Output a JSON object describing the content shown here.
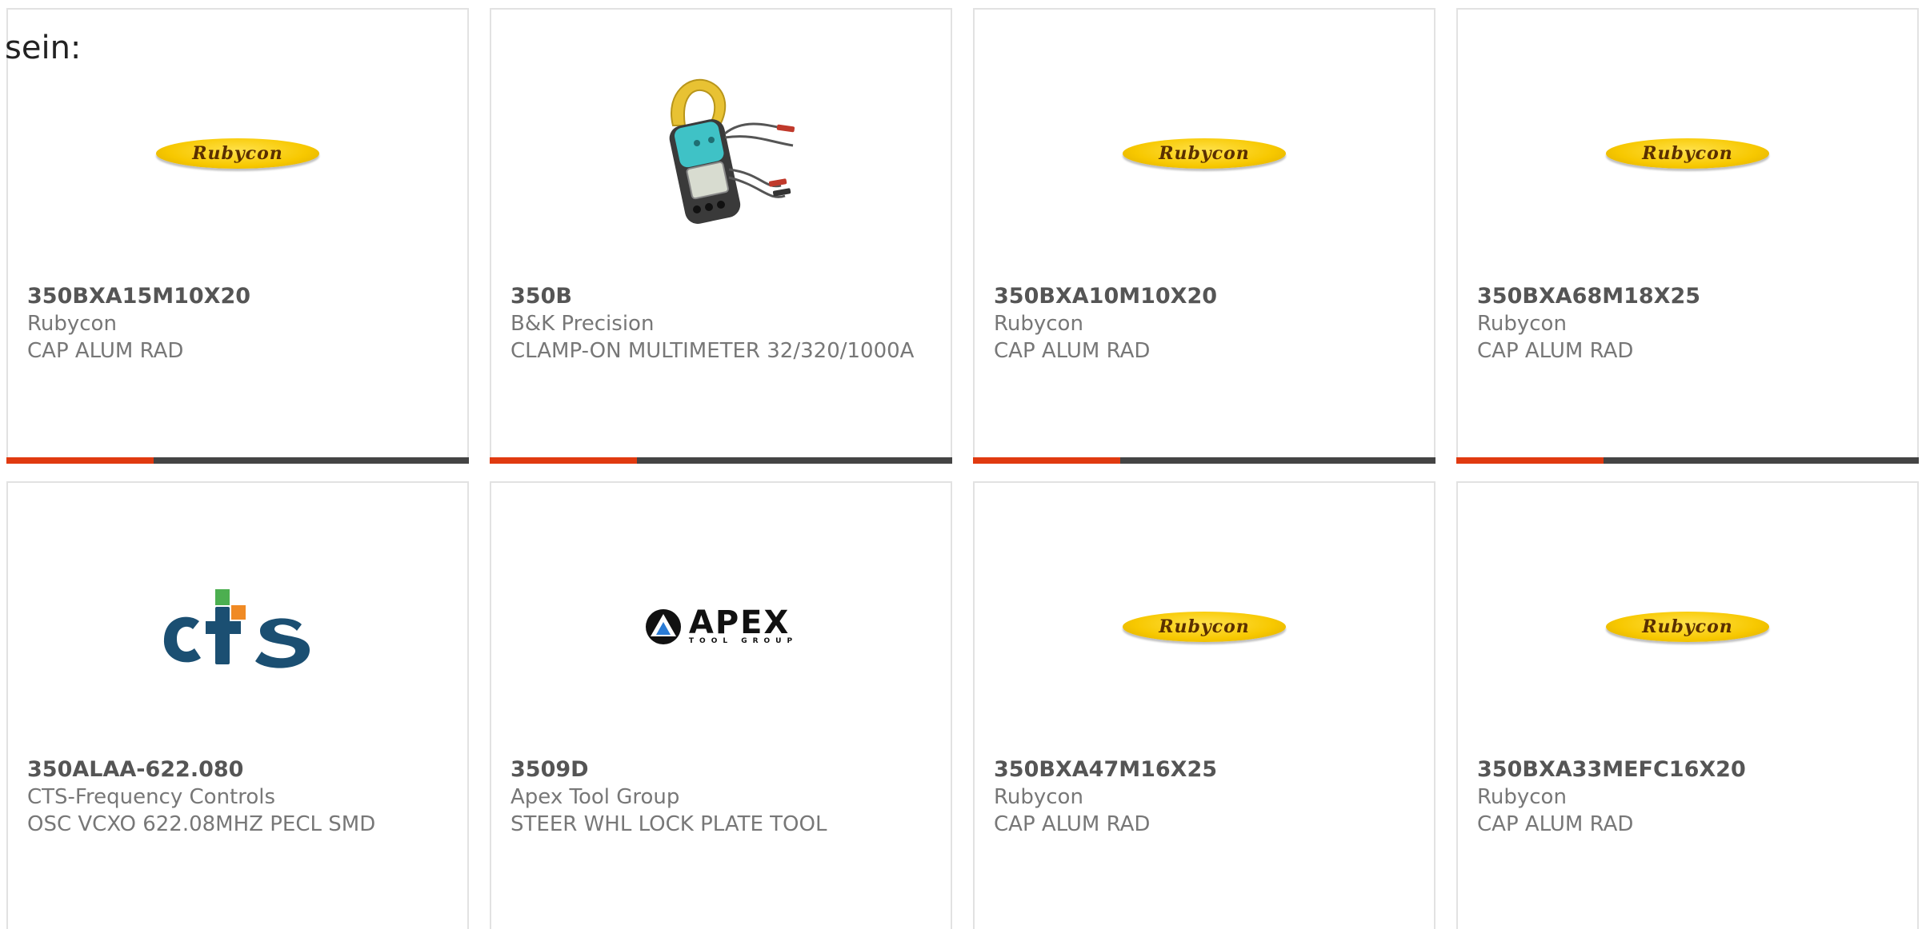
{
  "prefix_text": "sein:",
  "products": [
    {
      "part": "350BXA15M10X20",
      "manufacturer": "Rubycon",
      "description": "CAP ALUM RAD",
      "logo": "rubycon-logo",
      "logo_text": "Rubycon"
    },
    {
      "part": "350B",
      "manufacturer": "B&K Precision",
      "description": "CLAMP-ON MULTIMETER 32/320/1000A",
      "logo": "clamp-meter-photo"
    },
    {
      "part": "350BXA10M10X20",
      "manufacturer": "Rubycon",
      "description": "CAP ALUM RAD",
      "logo": "rubycon-logo",
      "logo_text": "Rubycon"
    },
    {
      "part": "350BXA68M18X25",
      "manufacturer": "Rubycon",
      "description": "CAP ALUM RAD",
      "logo": "rubycon-logo",
      "logo_text": "Rubycon"
    },
    {
      "part": "350ALAA-622.080",
      "manufacturer": "CTS-Frequency Controls",
      "description": "OSC VCXO 622.08MHZ PECL SMD",
      "logo": "cts-logo",
      "logo_text": "cts"
    },
    {
      "part": "3509D",
      "manufacturer": "Apex Tool Group",
      "description": "STEER WHL LOCK PLATE TOOL",
      "logo": "apex-logo",
      "logo_text": "APEX",
      "logo_subtext": "TOOL GROUP"
    },
    {
      "part": "350BXA47M16X25",
      "manufacturer": "Rubycon",
      "description": "CAP ALUM RAD",
      "logo": "rubycon-logo",
      "logo_text": "Rubycon"
    },
    {
      "part": "350BXA33MEFC16X20",
      "manufacturer": "Rubycon",
      "description": "CAP ALUM RAD",
      "logo": "rubycon-logo",
      "logo_text": "Rubycon"
    }
  ],
  "colors": {
    "accent_bar": "#e03a10",
    "bar_base": "#444444",
    "rubycon_yellow": "#f7c800",
    "cts_blue": "#1b4f72",
    "cts_green": "#4caf50",
    "cts_orange": "#f08a24"
  }
}
